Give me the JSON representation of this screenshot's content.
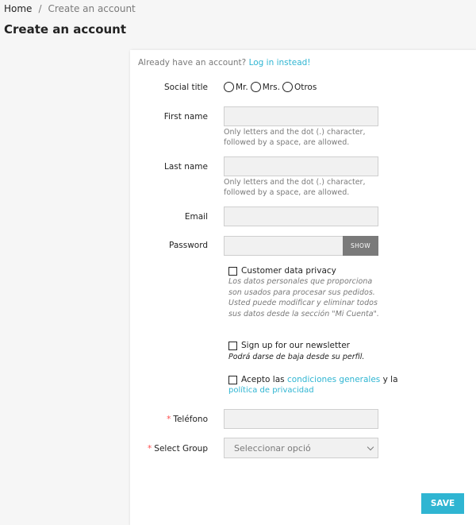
{
  "breadcrumb": {
    "home": "Home",
    "separator": "/",
    "current": "Create an account"
  },
  "page_title": "Create an account",
  "form": {
    "login_prompt": "Already have an account?",
    "login_link": "Log in instead!",
    "social_title": {
      "label": "Social title",
      "options": [
        "Mr.",
        "Mrs.",
        "Otros"
      ]
    },
    "first_name": {
      "label": "First name",
      "value": "",
      "help_line1": "Only letters and the dot (.) character,",
      "help_line2": "followed by a space, are allowed."
    },
    "last_name": {
      "label": "Last name",
      "value": "",
      "help_line1": "Only letters and the dot (.) character,",
      "help_line2": "followed by a space, are allowed."
    },
    "email": {
      "label": "Email",
      "value": ""
    },
    "password": {
      "label": "Password",
      "value": "",
      "show_label": "SHOW"
    },
    "privacy": {
      "label": "Customer data privacy",
      "note_lines": [
        "Los datos personales que proporciona",
        "son usados para procesar sus pedidos.",
        "Usted puede modificar y eliminar todos",
        "sus datos desde la sección \"Mi Cuenta\"."
      ]
    },
    "newsletter": {
      "label": "Sign up for our newsletter",
      "note": "Podrá darse de baja desde su perfil."
    },
    "terms": {
      "prefix": "Acepto las",
      "link1": "condiciones generales",
      "middle": "y la",
      "link2": "política de privacidad"
    },
    "telefono": {
      "required_mark": "*",
      "label": "Teléfono",
      "value": ""
    },
    "group": {
      "required_mark": "*",
      "label": "Select Group",
      "selected": "Seleccionar opció"
    },
    "save_label": "SAVE"
  },
  "colors": {
    "accent": "#2fb5d2",
    "required": "#ff4c4c",
    "muted": "#7a7a7a"
  }
}
